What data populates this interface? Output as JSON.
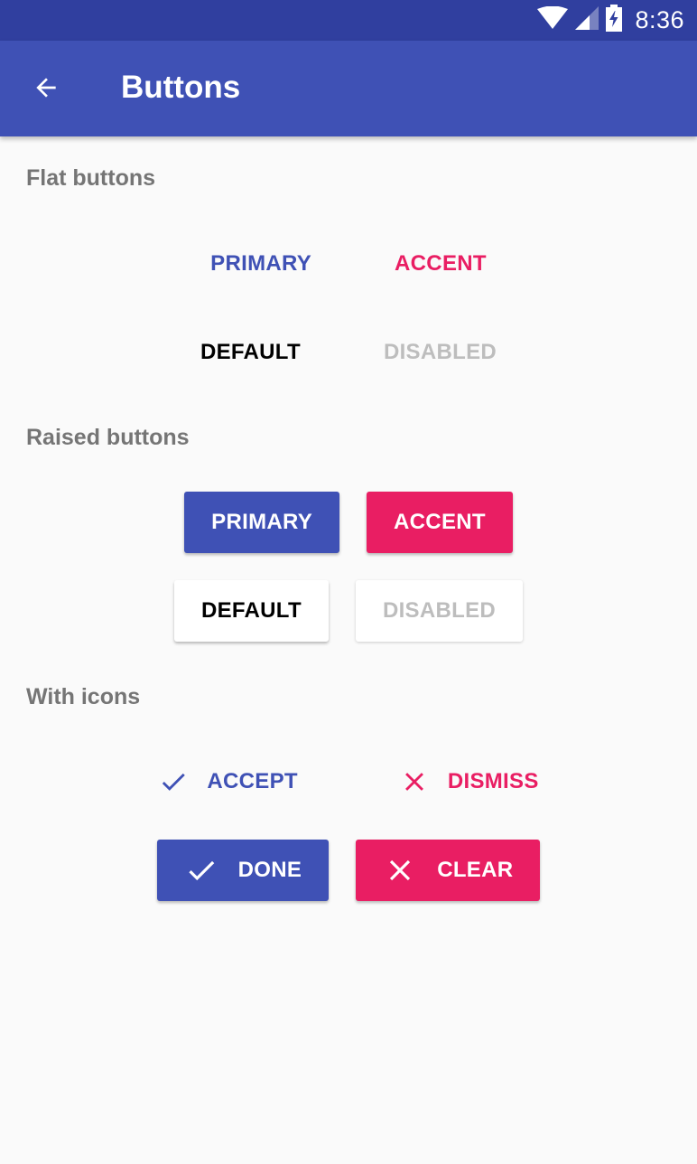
{
  "status_bar": {
    "time": "8:36",
    "icons": [
      "wifi-icon",
      "signal-icon",
      "battery-charging-icon"
    ]
  },
  "app_bar": {
    "title": "Buttons",
    "back_icon": "arrow-back-icon"
  },
  "sections": {
    "flat": {
      "title": "Flat buttons",
      "primary": "PRIMARY",
      "accent": "ACCENT",
      "default": "DEFAULT",
      "disabled": "DISABLED"
    },
    "raised": {
      "title": "Raised buttons",
      "primary": "PRIMARY",
      "accent": "ACCENT",
      "default": "DEFAULT",
      "disabled": "DISABLED"
    },
    "icons": {
      "title": "With icons",
      "accept": "ACCEPT",
      "dismiss": "DISMISS",
      "done": "DONE",
      "clear": "CLEAR"
    }
  },
  "colors": {
    "primary": "#3F51B5",
    "primary_dark": "#303F9F",
    "accent": "#E91E63",
    "disabled_text": "#BDBDBD",
    "section_title": "#757575",
    "background": "#FAFAFA"
  }
}
